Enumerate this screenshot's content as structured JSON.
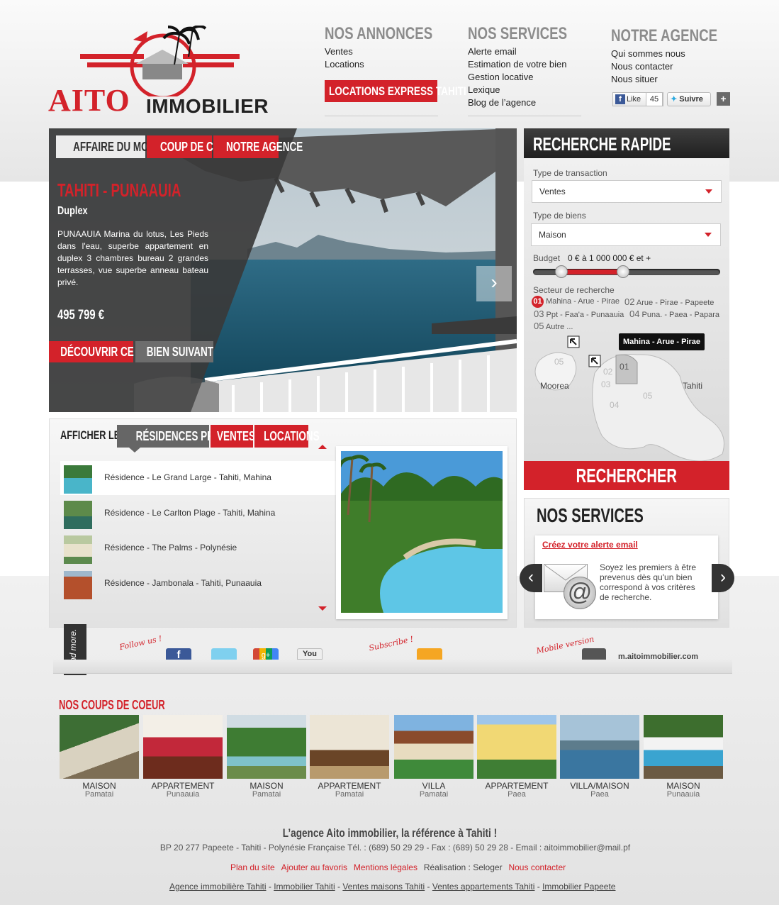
{
  "logo": {
    "word": "AITO",
    "sub": "IMMOBILIER"
  },
  "nav": {
    "annonces": {
      "title": "NOS ANNONCES",
      "links": [
        "Ventes",
        "Locations"
      ],
      "button": "LOCATIONS EXPRESS TAHITI"
    },
    "services": {
      "title": "NOS SERVICES",
      "links": [
        "Alerte email",
        "Estimation de votre bien",
        "Gestion locative",
        "Lexique",
        "Blog de l’agence"
      ]
    },
    "agence": {
      "title": "NOTRE AGENCE",
      "links": [
        "Qui sommes nous",
        "Nous contacter",
        "Nous situer"
      ]
    },
    "social": {
      "like": "Like",
      "like_count": "45",
      "follow": "Suivre",
      "plus": "+"
    }
  },
  "hero": {
    "tabs": [
      "AFFAIRE DU MOMENT",
      "COUP DE COEUR",
      "NOTRE AGENCE"
    ],
    "location": "TAHITI - PUNAAUIA",
    "type": "Duplex",
    "description": "PUNAAUIA Marina du lotus, Les Pieds dans l'eau, superbe appartement en duplex 3 chambres bureau 2 grandes terrasses, vue superbe anneau bateau privé.",
    "price": "495 799 €",
    "btn_discover": "DÉCOUVRIR CE BIEN",
    "btn_next": "BIEN SUIVANT",
    "next_arrow": "›"
  },
  "search": {
    "title": "RECHERCHE RAPIDE",
    "transaction_label": "Type de transaction",
    "transaction_value": "Ventes",
    "biens_label": "Type de biens",
    "biens_value": "Maison",
    "budget_label": "Budget",
    "budget_value": "0 € à 1 000 000 € et +",
    "budget_min_fraction": 0.15,
    "budget_max_fraction": 0.48,
    "secteur_label": "Secteur de recherche",
    "sectors": [
      {
        "num": "01",
        "name": "Mahina - Arue - Pirae",
        "active": true
      },
      {
        "num": "02",
        "name": "Arue - Pirae - Papeete"
      },
      {
        "num": "03",
        "name": "Ppt - Faa'a - Punaauia"
      },
      {
        "num": "04",
        "name": "Puna. - Paea - Papara"
      },
      {
        "num": "05",
        "name": "Autre ..."
      }
    ],
    "map": {
      "tooltip": "Mahina - Arue - Pirae",
      "moorea_label": "Moorea",
      "tahiti_label": "Tahiti",
      "moorea_num": "05",
      "zones": [
        "01",
        "02",
        "03",
        "04",
        "05"
      ]
    },
    "submit": "RECHERCHER"
  },
  "listings": {
    "label": "AFFICHER LES",
    "tabs": [
      "RÉSIDENCES PRESTIGE",
      "VENTES",
      "LOCATIONS"
    ],
    "items": [
      {
        "text": "Résidence  -  Le Grand Large  -  Tahiti, Mahina"
      },
      {
        "text": "Résidence  -  Le Carlton Plage  -  Tahiti, Mahina"
      },
      {
        "text": "Résidence  -  The Palms  -  Polynésie"
      },
      {
        "text": "Résidence  -  Jambonala  -  Tahiti, Punaauia"
      }
    ]
  },
  "services_box": {
    "title": "NOS SERVICES",
    "link": "Créez votre alerte email",
    "text": "Soyez les premiers à être prevenus dès qu'un bien correspond à vos critères de recherche."
  },
  "social_bar": {
    "and_more": "And more.",
    "follow": "Follow us !",
    "subscribe": "Subscribe !",
    "mobile": "Mobile version",
    "mobile_url": "m.aitoimmobilier.com",
    "youtube": "You"
  },
  "coups": {
    "title": "NOS COUPS DE COEUR",
    "items": [
      {
        "type": "MAISON",
        "place": "Pamatai"
      },
      {
        "type": "APPARTEMENT",
        "place": "Punaauia"
      },
      {
        "type": "MAISON",
        "place": "Pamatai"
      },
      {
        "type": "APPARTEMENT",
        "place": "Pamatai"
      },
      {
        "type": "VILLA",
        "place": "Pamatai"
      },
      {
        "type": "APPARTEMENT",
        "place": "Paea"
      },
      {
        "type": "VILLA/MAISON",
        "place": "Paea"
      },
      {
        "type": "MAISON",
        "place": "Punaauia"
      }
    ]
  },
  "footer": {
    "tagline": "L’agence Aito immobilier, la référence à Tahiti !",
    "address": "BP 20 277 Papeete - Tahiti - Polynésie Française Tél. : (689) 50 29 29 - Fax : (689) 50 29 28 - Email : aitoimmobilier@mail.pf",
    "links": {
      "plan": "Plan du site",
      "favoris": "Ajouter au favoris",
      "mentions": "Mentions légales",
      "realisation": "Réalisation : Seloger",
      "contact": "Nous contacter"
    },
    "seo": [
      "Agence immobilière Tahiti",
      "Immobilier Tahiti",
      "Ventes maisons Tahiti",
      "Ventes appartements Tahiti",
      "Immobilier Papeete"
    ]
  },
  "colors": {
    "accent": "#d3222a",
    "dark": "#333333"
  }
}
